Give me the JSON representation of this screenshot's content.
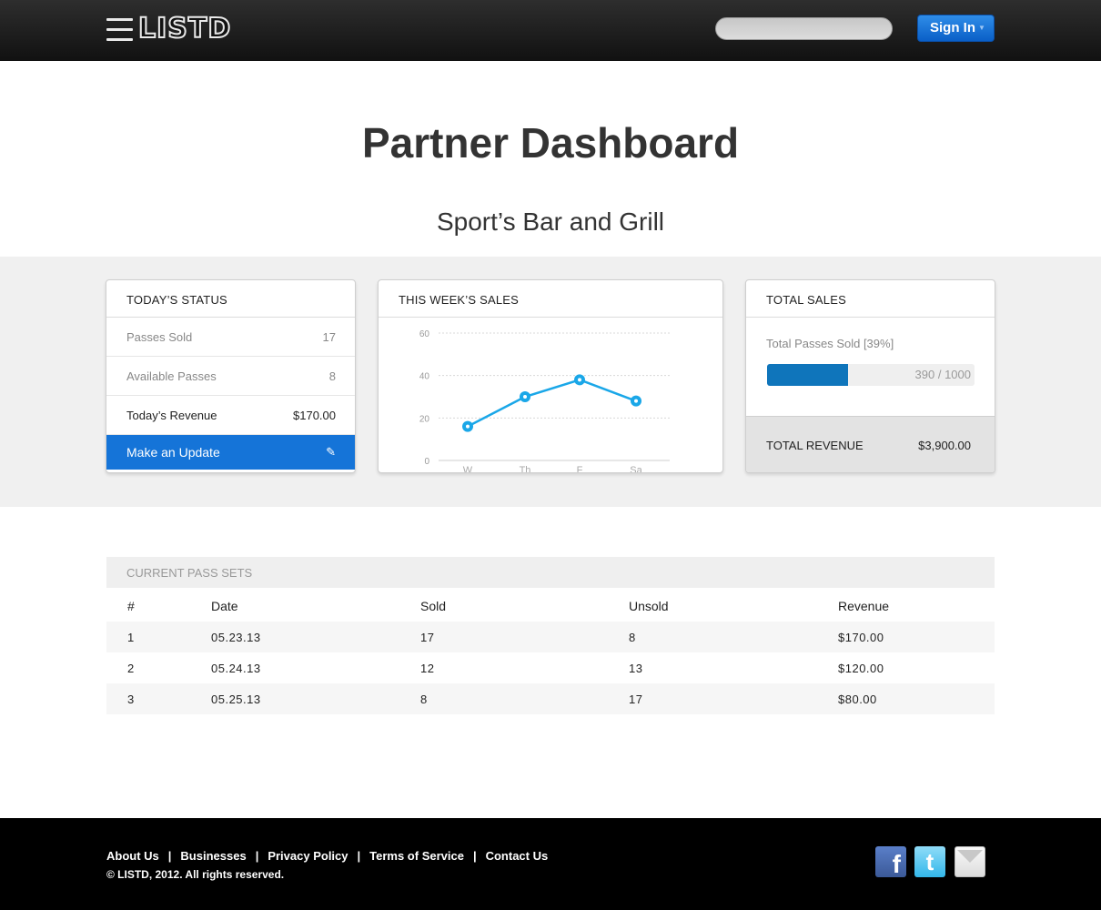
{
  "header": {
    "brand": "LISTD",
    "search_placeholder": "",
    "signin_label": "Sign In",
    "caret": "▼"
  },
  "page": {
    "title": "Partner Dashboard",
    "subtitle": "Sport’s Bar and Grill"
  },
  "today_status": {
    "heading": "TODAY’S STATUS",
    "rows": [
      {
        "label": "Passes Sold",
        "value": "17"
      },
      {
        "label": "Available Passes",
        "value": "8"
      },
      {
        "label": "Today’s Revenue",
        "value": "$170.00"
      }
    ],
    "update_label": "Make an Update",
    "update_icon": "✎"
  },
  "weekly_sales": {
    "heading": "THIS WEEK’S SALES"
  },
  "chart_data": {
    "type": "line",
    "title": "THIS WEEK’S SALES",
    "categories": [
      "W",
      "Th",
      "F",
      "Sa"
    ],
    "values": [
      16,
      30,
      38,
      28
    ],
    "ylim": [
      0,
      60
    ],
    "yticks": [
      0,
      20,
      40,
      60
    ],
    "grid": true,
    "color": "#1aa7e8"
  },
  "total_sales": {
    "heading": "TOTAL SALES",
    "passes_label": "Total Passes Sold  [39%]",
    "progress_fraction": 0.39,
    "progress_text": "390 / 1000",
    "revenue_label": "TOTAL REVENUE",
    "revenue_value": "$3,900.00",
    "accent": "#0f75bb"
  },
  "pass_sets": {
    "heading": "CURRENT PASS SETS",
    "columns": [
      "#",
      "Date",
      "Sold",
      "Unsold",
      "Revenue"
    ],
    "rows": [
      [
        "1",
        "05.23.13",
        "17",
        "8",
        "$170.00"
      ],
      [
        "2",
        "05.24.13",
        "12",
        "13",
        "$120.00"
      ],
      [
        "3",
        "05.25.13",
        "8",
        "17",
        "$80.00"
      ]
    ]
  },
  "footer": {
    "links": [
      "About Us",
      "Businesses",
      "Privacy Policy",
      "Terms of Service",
      "Contact Us"
    ],
    "separator": "|",
    "copyright": "© LISTD, 2012. All rights reserved.",
    "social": {
      "facebook": "f",
      "twitter": "t",
      "mail_icon": "mail-icon"
    }
  }
}
